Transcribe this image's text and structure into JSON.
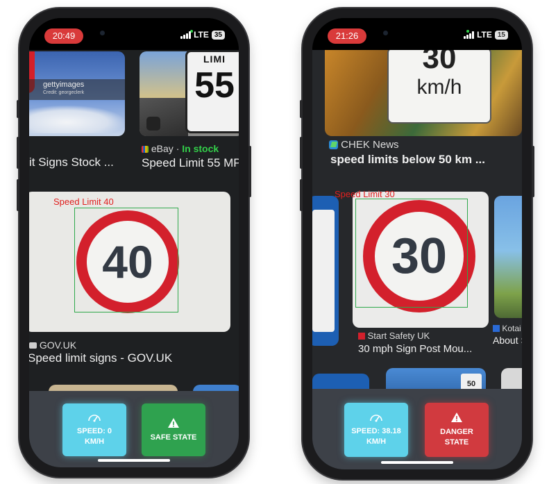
{
  "phone_left": {
    "status": {
      "time": "20:49",
      "network": "LTE",
      "battery": "35"
    },
    "cards": {
      "getty_watermark": "gettyimages",
      "getty_credit": "Credit: georgeclerk",
      "top_sign_text": "55",
      "top_sign_partial": "LIMI",
      "item1_title": "it Signs Stock ...",
      "item2_source": "eBay",
      "item2_separator": "·",
      "item2_stock": "In stock",
      "item2_title": "Speed Limit 55 MP",
      "main_sign_value": "40",
      "main_source": "GOV.UK",
      "main_title": "Speed limit signs - GOV.UK"
    },
    "detection": {
      "label": "Speed Limit 40"
    },
    "buttons": {
      "speed_label": "SPEED: 0 KM/H",
      "state_label": "SAFE STATE"
    }
  },
  "phone_right": {
    "status": {
      "time": "21:26",
      "network": "LTE",
      "battery": "15"
    },
    "cards": {
      "top_sign_value": "30",
      "top_sign_unit": "km/h",
      "top_source": "CHEK News",
      "top_title": "speed limits below 50 km ...",
      "main_sign_value": "30",
      "main_source": "Start Safety UK",
      "main_title": "30 mph Sign Post Mou...",
      "right_source": "Kotai",
      "right_title": "About S",
      "bottom_sign": "50"
    },
    "detection": {
      "label": "Speed Limit 30"
    },
    "buttons": {
      "speed_label": "SPEED: 38.18 KM/H",
      "state_label": "DANGER STATE"
    }
  },
  "colors": {
    "speed_button": "#5ed2ea",
    "safe_button": "#2fa24f",
    "danger_button": "#d13a3f",
    "detection_box": "#2ea84a",
    "detection_label": "#e0201f",
    "time_pill": "#d93a3a"
  },
  "icons": {
    "speed_button": "speedometer-icon",
    "safe_button": "warning-icon",
    "danger_button": "warning-icon"
  }
}
